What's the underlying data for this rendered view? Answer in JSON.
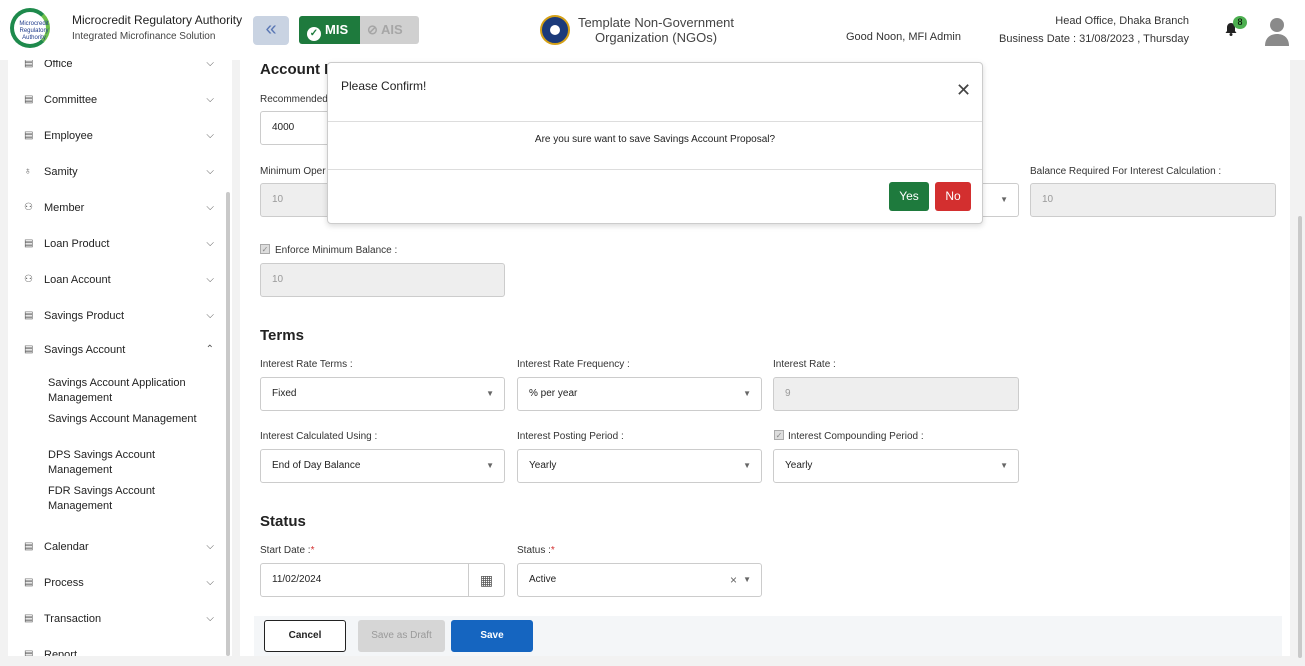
{
  "header": {
    "logo_text": "Microcredit Regulatory Authority",
    "title": "Microcredit Regulatory Authority",
    "subtitle": "Integrated Microfinance Solution",
    "mis_label": "MIS",
    "ais_label": "AIS",
    "org_name": "Template Non-Government Organization (NGOs)",
    "greeting": "Good Noon, MFI Admin",
    "branch": "Head Office, Dhaka Branch",
    "business_date": "Business Date : 31/08/2023 , Thursday",
    "notification_count": "8"
  },
  "sidebar": {
    "items": [
      {
        "label": "Office"
      },
      {
        "label": "Committee"
      },
      {
        "label": "Employee"
      },
      {
        "label": "Samity"
      },
      {
        "label": "Member"
      },
      {
        "label": "Loan Product"
      },
      {
        "label": "Loan Account"
      },
      {
        "label": "Savings Product"
      },
      {
        "label": "Savings Account"
      },
      {
        "label": "Calendar"
      },
      {
        "label": "Process"
      },
      {
        "label": "Transaction"
      },
      {
        "label": "Report"
      }
    ],
    "sub_items": [
      "Savings Account Application Management",
      "Savings Account Management",
      "DPS Savings Account Management",
      "FDR Savings Account Management"
    ]
  },
  "form": {
    "account_section_title": "Account In",
    "recommended_label": "Recommended",
    "recommended_value": "4000",
    "min_open_label": "Minimum Oper",
    "min_open_value": "10",
    "balance_interest_label": "Balance Required For Interest Calculation :",
    "balance_interest_value": "10",
    "enforce_min_label": "Enforce Minimum Balance :",
    "enforce_min_value": "10",
    "terms_title": "Terms",
    "interest_rate_terms_label": "Interest Rate Terms :",
    "interest_rate_terms_value": "Fixed",
    "interest_rate_freq_label": "Interest Rate Frequency :",
    "interest_rate_freq_value": "% per year",
    "interest_rate_label": "Interest Rate :",
    "interest_rate_value": "9",
    "interest_calc_label": "Interest Calculated Using :",
    "interest_calc_value": "End of Day Balance",
    "interest_posting_label": "Interest Posting Period :",
    "interest_posting_value": "Yearly",
    "interest_compound_label": "Interest Compounding Period :",
    "interest_compound_value": "Yearly",
    "status_title": "Status",
    "start_date_label": "Start Date :",
    "start_date_value": "11/02/2024",
    "status_label": "Status :",
    "status_value": "Active",
    "required_mark": "*"
  },
  "actions": {
    "cancel": "Cancel",
    "save_draft": "Save as Draft",
    "save": "Save"
  },
  "modal": {
    "title": "Please Confirm!",
    "message": "Are you sure want to save Savings Account Proposal?",
    "yes": "Yes",
    "no": "No"
  },
  "colors": {
    "primary_green": "#1e7a3d",
    "save_blue": "#1565c0",
    "danger_red": "#d32f2f"
  }
}
